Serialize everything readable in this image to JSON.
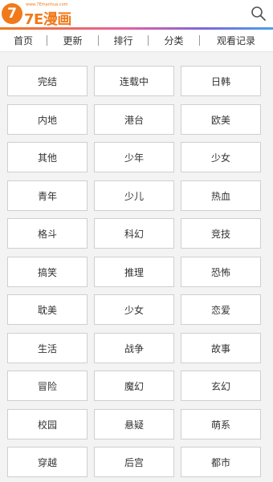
{
  "header": {
    "logo_mark": "7",
    "logo_url": "www.7Emanhua.com",
    "logo_name": "7E漫画",
    "search_icon": "search-icon"
  },
  "colors": {
    "brand": "#f07a1a",
    "accent_gradient": [
      "#f07a1a",
      "#e85ea0",
      "#7a6ad8",
      "#4aa0e8"
    ]
  },
  "nav": {
    "items": [
      "首页",
      "更新",
      "排行",
      "分类",
      "观看记录"
    ]
  },
  "categories": [
    "完结",
    "连载中",
    "日韩",
    "内地",
    "港台",
    "欧美",
    "其他",
    "少年",
    "少女",
    "青年",
    "少儿",
    "热血",
    "格斗",
    "科幻",
    "竞技",
    "搞笑",
    "推理",
    "恐怖",
    "耽美",
    "少女",
    "恋爱",
    "生活",
    "战争",
    "故事",
    "冒险",
    "魔幻",
    "玄幻",
    "校园",
    "悬疑",
    "萌系",
    "穿越",
    "后宫",
    "都市"
  ]
}
